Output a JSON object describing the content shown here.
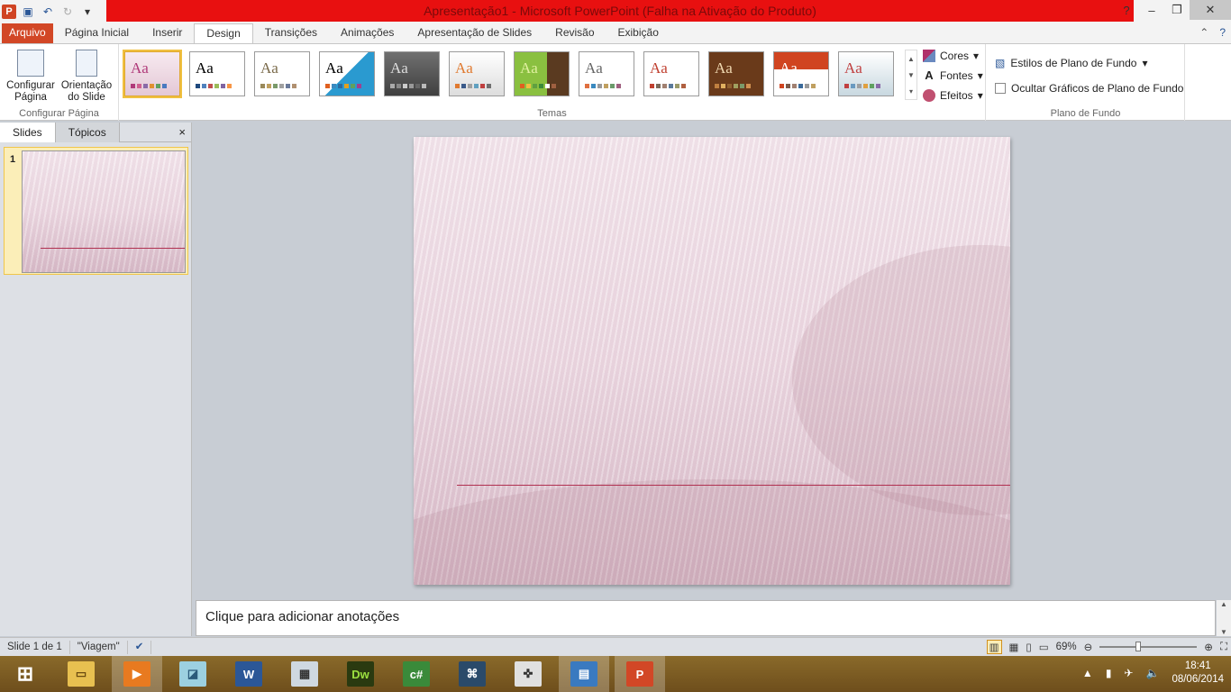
{
  "window": {
    "title": "Apresentação1  -  Microsoft PowerPoint (Falha na Ativação do Produto)"
  },
  "qat": {
    "app_icon": "P"
  },
  "tabs": [
    "Arquivo",
    "Página Inicial",
    "Inserir",
    "Design",
    "Transições",
    "Animações",
    "Apresentação de Slides",
    "Revisão",
    "Exibição"
  ],
  "ribbon": {
    "page_setup": {
      "btn1": "Configurar Página",
      "btn2": "Orientação do Slide",
      "group": "Configurar Página"
    },
    "themes": {
      "group": "Temas",
      "sample": "Aa",
      "count": 12
    },
    "options": {
      "colors": "Cores",
      "fonts": "Fontes",
      "effects": "Efeitos"
    },
    "background": {
      "styles": "Estilos de Plano de Fundo",
      "hide": "Ocultar Gráficos de Plano de Fundo",
      "group": "Plano de Fundo"
    }
  },
  "panel": {
    "tab_slides": "Slides",
    "tab_topics": "Tópicos",
    "close": "×",
    "slide_number": "1"
  },
  "notes": {
    "placeholder": "Clique para adicionar anotações"
  },
  "status": {
    "slide": "Slide 1 de 1",
    "theme": "\"Viagem\"",
    "zoom": "69%"
  },
  "taskbar": {
    "icons": [
      "windows-start",
      "file-explorer",
      "media-player",
      "notes",
      "word",
      "calculator",
      "dreamweaver",
      "csharp",
      "mysql",
      "games",
      "remote",
      "powerpoint"
    ]
  },
  "clock": {
    "time": "18:41",
    "date": "08/06/2014"
  },
  "colors": {
    "title_red": "#e81010",
    "file_tab": "#d24726"
  }
}
